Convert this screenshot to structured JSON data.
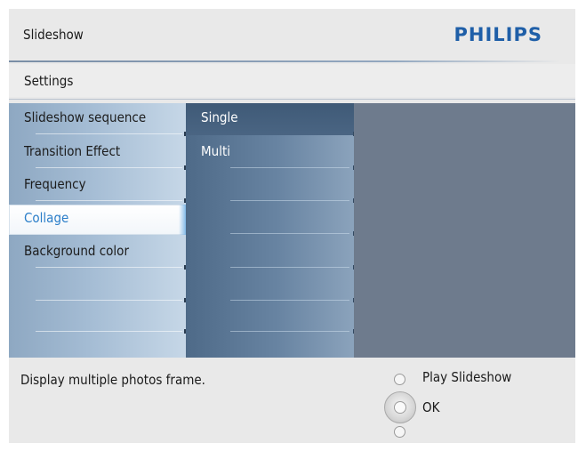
{
  "header": {
    "title": "Slideshow",
    "brand": "PHILIPS"
  },
  "breadcrumb": {
    "label": "Settings"
  },
  "menu": {
    "items": [
      {
        "label": "Slideshow sequence"
      },
      {
        "label": "Transition Effect"
      },
      {
        "label": "Frequency"
      },
      {
        "label": "Collage",
        "selected": true
      },
      {
        "label": "Background color"
      }
    ]
  },
  "submenu": {
    "items": [
      {
        "label": "Single",
        "highlighted": true
      },
      {
        "label": "Multi"
      }
    ]
  },
  "status": {
    "description": "Display multiple photos frame."
  },
  "controls": {
    "play_label": "Play Slideshow",
    "ok_label": "OK"
  },
  "colors": {
    "brand": "#1f5fa8",
    "selected_text": "#2b7ec9",
    "panel_right": "#6e7b8d"
  }
}
